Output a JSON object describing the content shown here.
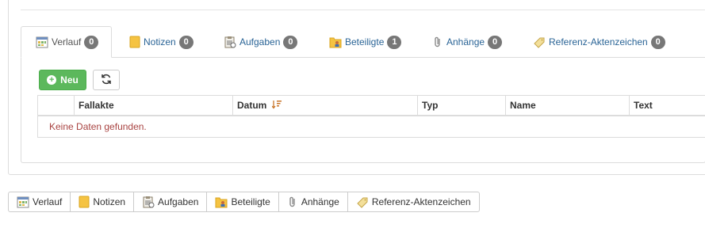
{
  "tabs": [
    {
      "label": "Verlauf",
      "count": "0",
      "icon": "calendar-icon",
      "active": true
    },
    {
      "label": "Notizen",
      "count": "0",
      "icon": "note-icon",
      "active": false
    },
    {
      "label": "Aufgaben",
      "count": "0",
      "icon": "clipboard-icon",
      "active": false
    },
    {
      "label": "Beteiligte",
      "count": "1",
      "icon": "contacts-folder-icon",
      "active": false
    },
    {
      "label": "Anhänge",
      "count": "0",
      "icon": "paperclip-icon",
      "active": false
    },
    {
      "label": "Referenz-Aktenzeichen",
      "count": "0",
      "icon": "tag-icon",
      "active": false
    }
  ],
  "toolbar": {
    "new_label": "Neu",
    "refresh_icon": "refresh-icon"
  },
  "grid": {
    "columns": [
      "",
      "Fallakte",
      "Datum",
      "Typ",
      "Name",
      "Text"
    ],
    "sort_icon": "sort-desc-icon",
    "empty_message": "Keine Daten gefunden."
  },
  "bottom_buttons": [
    {
      "label": "Verlauf",
      "icon": "calendar-icon"
    },
    {
      "label": "Notizen",
      "icon": "note-icon"
    },
    {
      "label": "Aufgaben",
      "icon": "clipboard-icon"
    },
    {
      "label": "Beteiligte",
      "icon": "contacts-folder-icon"
    },
    {
      "label": "Anhänge",
      "icon": "paperclip-icon"
    },
    {
      "label": "Referenz-Aktenzeichen",
      "icon": "tag-icon"
    }
  ],
  "colors": {
    "tab_link": "#2a6496",
    "badge": "#777777",
    "new_button": "#5cb85c",
    "empty_text": "#a94442"
  }
}
